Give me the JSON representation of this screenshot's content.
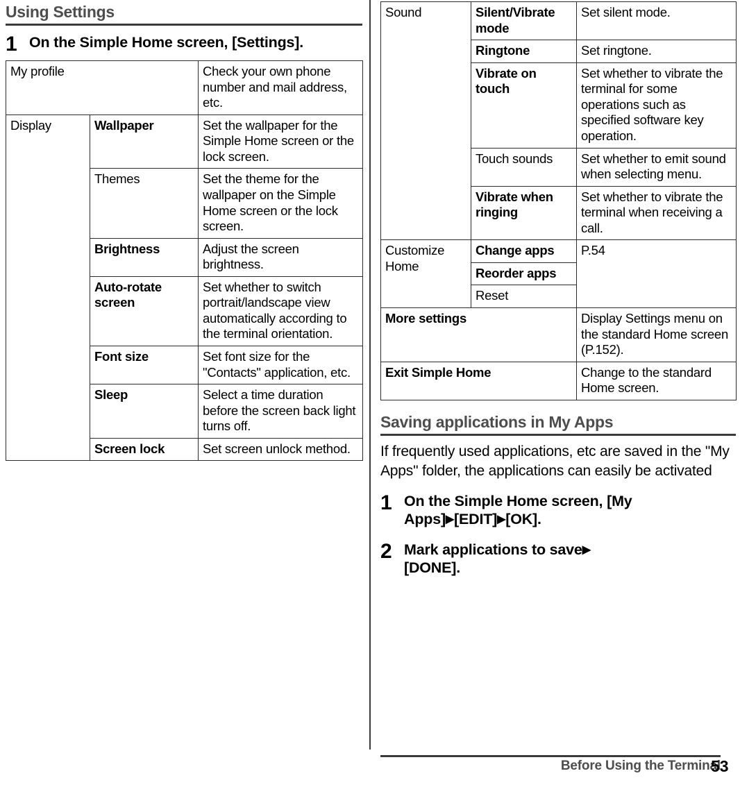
{
  "left": {
    "heading": "Using Settings",
    "step": {
      "num": "1",
      "text_prefix": "On the Simple Home screen, [",
      "text_bold": "Settings",
      "text_suffix": "]."
    },
    "table": {
      "rows": [
        {
          "c1": "My profile",
          "c1_bold": false,
          "c2": "",
          "c3": "Check your own phone number and mail address, etc."
        },
        {
          "c1": "Display",
          "c1_bold": false,
          "c2": "Wallpaper",
          "c3": "Set the wallpaper for the Simple Home screen or the lock screen."
        },
        {
          "c1": "",
          "c2": "Themes",
          "c3": "Set the theme for the wallpaper on the Simple Home screen or the lock screen."
        },
        {
          "c1": "",
          "c2": "Brightness",
          "c3": "Adjust the screen brightness."
        },
        {
          "c1": "",
          "c2": "Auto-rotate screen",
          "c3": "Set whether to switch portrait/landscape view automatically according to the terminal orientation."
        },
        {
          "c1": "",
          "c2": "Font size",
          "c3": "Set font size for the \"Contacts\" application, etc."
        },
        {
          "c1": "",
          "c2": "Sleep",
          "c3": "Select a time duration before the screen back light turns off."
        },
        {
          "c1": "",
          "c2": "Screen lock",
          "c3": "Set screen unlock method."
        }
      ]
    }
  },
  "right": {
    "table": {
      "rows": [
        {
          "c1": "Sound",
          "c2": "Silent/Vibrate mode",
          "c3": "Set silent mode."
        },
        {
          "c1": "",
          "c2": "Ringtone",
          "c3": "Set ringtone."
        },
        {
          "c1": "",
          "c2": "Vibrate on touch",
          "c3": "Set whether to vibrate the terminal for some operations such as specified software key operation."
        },
        {
          "c1": "",
          "c2": "Touch sounds",
          "c3": "Set whether to emit sound when selecting menu."
        },
        {
          "c1": "",
          "c2": "Vibrate when ringing",
          "c3": "Set whether to vibrate the terminal when receiving a call."
        },
        {
          "c1": "Customize Home",
          "c2": "Change apps",
          "c3": "P.54"
        },
        {
          "c1": "",
          "c2": "Reorder apps",
          "c3": ""
        },
        {
          "c1": "",
          "c2": "Reset",
          "c3": ""
        },
        {
          "c1": "More settings",
          "c2": "",
          "c3": "Display Settings menu on the standard Home screen (P.152)."
        },
        {
          "c1": "Exit Simple Home",
          "c2": "",
          "c3": "Change to the standard Home screen."
        }
      ]
    },
    "heading": "Saving applications in My Apps",
    "paragraph": "If frequently used applications, etc are saved in the \"My Apps\" folder, the applications can easily be activated",
    "steps": [
      {
        "num": "1",
        "part1": "On the Simple Home screen, [My Apps]",
        "arrow1": "▶",
        "part2": "[EDIT]",
        "arrow2": "▶",
        "part3": "[OK]."
      },
      {
        "num": "2",
        "part1": "Mark applications to save",
        "arrow1": "▶",
        "part2": "[DONE]."
      }
    ]
  },
  "footer": {
    "text": "Before Using the Terminal",
    "page": "53"
  }
}
